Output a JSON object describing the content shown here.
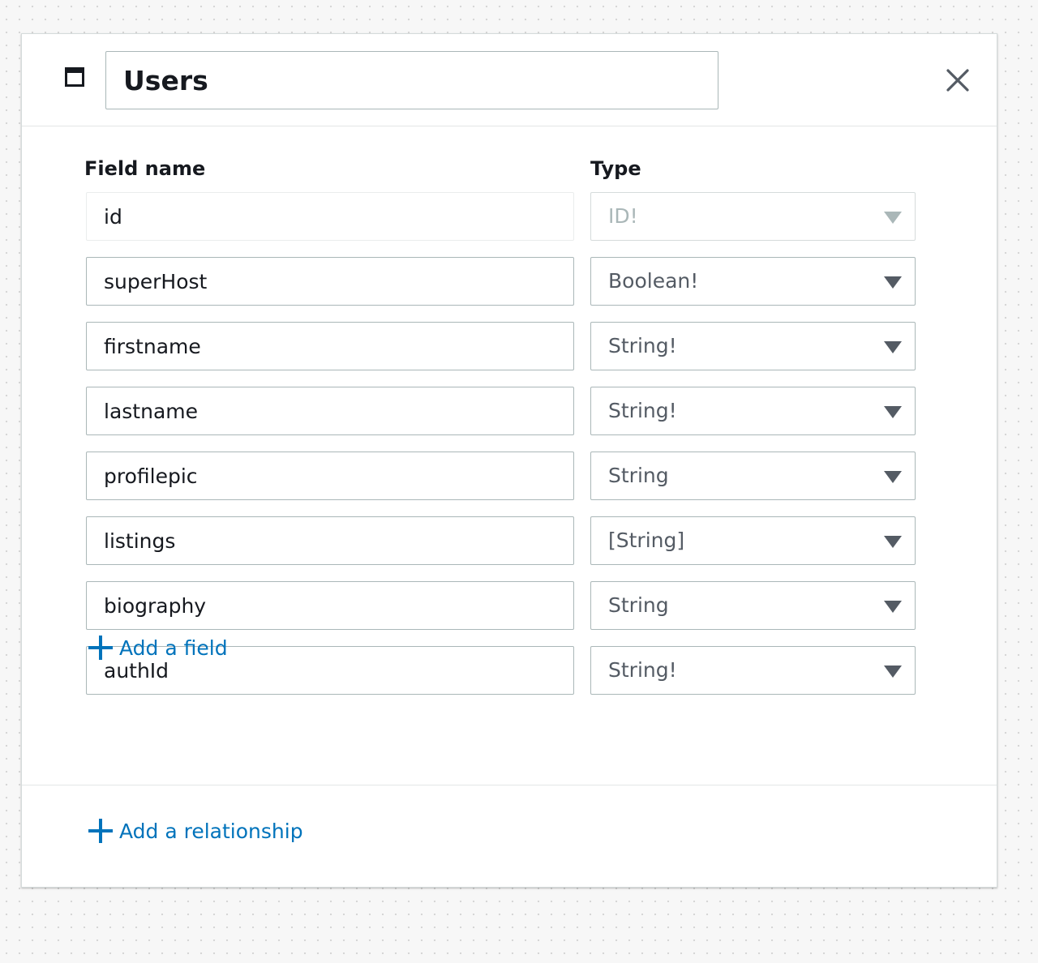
{
  "table": {
    "name": "Users",
    "icon": "table-icon"
  },
  "columns": {
    "field_name": "Field name",
    "type": "Type"
  },
  "fields": [
    {
      "name": "id",
      "type": "ID!",
      "disabled": true
    },
    {
      "name": "superHost",
      "type": "Boolean!",
      "disabled": false
    },
    {
      "name": "firstname",
      "type": "String!",
      "disabled": false
    },
    {
      "name": "lastname",
      "type": "String!",
      "disabled": false
    },
    {
      "name": "profilepic",
      "type": "String",
      "disabled": false
    },
    {
      "name": "listings",
      "type": "[String]",
      "disabled": false
    },
    {
      "name": "biography",
      "type": "String",
      "disabled": false
    },
    {
      "name": "authId",
      "type": "String!",
      "disabled": false
    }
  ],
  "actions": {
    "add_field": "Add a field",
    "add_relationship": "Add a relationship"
  },
  "colors": {
    "link": "#0073bb",
    "text": "#16191f",
    "border": "#aab7b8",
    "muted": "#aab7b8"
  }
}
